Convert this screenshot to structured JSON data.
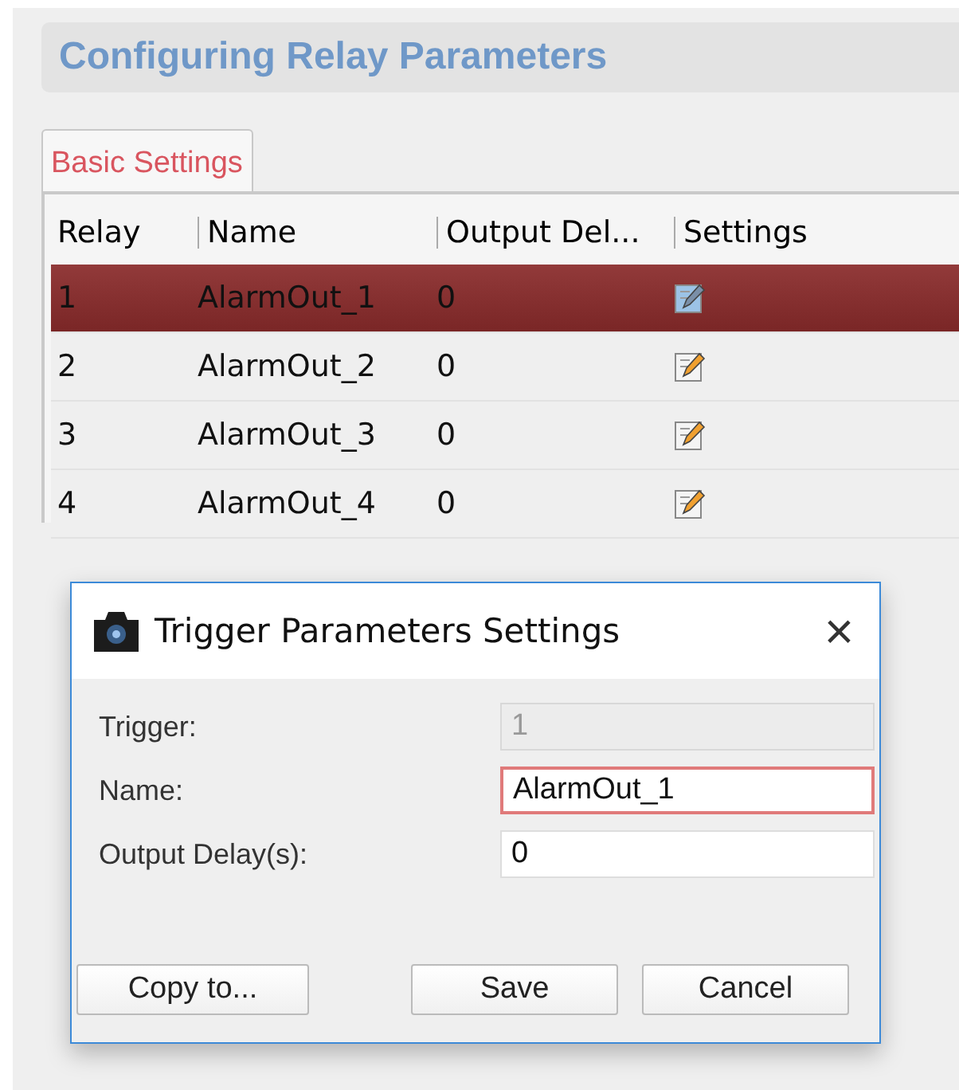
{
  "page": {
    "title": "Configuring Relay Parameters"
  },
  "tabs": [
    {
      "label": "Basic Settings",
      "selected": true
    }
  ],
  "table": {
    "columns": [
      "Relay",
      "Name",
      "Output Del...",
      "Settings"
    ],
    "rows": [
      {
        "relay": "1",
        "name": "AlarmOut_1",
        "output_delay": "0",
        "selected": true
      },
      {
        "relay": "2",
        "name": "AlarmOut_2",
        "output_delay": "0",
        "selected": false
      },
      {
        "relay": "3",
        "name": "AlarmOut_3",
        "output_delay": "0",
        "selected": false
      },
      {
        "relay": "4",
        "name": "AlarmOut_4",
        "output_delay": "0",
        "selected": false
      }
    ]
  },
  "dialog": {
    "title": "Trigger Parameters Settings",
    "close": "×",
    "fields": [
      {
        "label": "Trigger:",
        "value": "1",
        "disabled": true,
        "focused": false
      },
      {
        "label": "Name:",
        "value": "AlarmOut_1",
        "disabled": false,
        "focused": true
      },
      {
        "label": "Output Delay(s):",
        "value": "0",
        "disabled": false,
        "focused": false
      }
    ],
    "buttons": [
      "Copy to...",
      "Save",
      "Cancel"
    ]
  }
}
